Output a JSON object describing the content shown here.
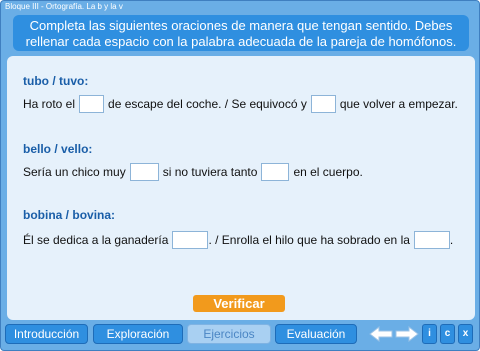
{
  "window": {
    "title": "Bloque III - Ortografía. La b y la v"
  },
  "instructions": "Completa las siguientes oraciones de manera que tengan sentido. Debes rellenar cada espacio con la palabra adecuada de la pareja de homófonos.",
  "exercises": [
    {
      "word1": "tubo",
      "slash": "/",
      "word2": "tuvo",
      "colon": ":",
      "parts": [
        "Ha roto el",
        "de escape del coche. / Se equivocó y",
        "que volver a empezar."
      ],
      "blanks": [
        "",
        ""
      ]
    },
    {
      "word1": "bello",
      "slash": "/",
      "word2": "vello",
      "colon": ":",
      "parts": [
        "Sería un chico muy",
        "si no tuviera tanto",
        "en el cuerpo."
      ],
      "blanks": [
        "",
        ""
      ]
    },
    {
      "word1": "bobina",
      "slash": "/",
      "word2": "bovina",
      "colon": ":",
      "parts": [
        "Él se dedica a la ganadería",
        ". / Enrolla el hilo que ha sobrado en la",
        "."
      ],
      "blanks": [
        "",
        ""
      ]
    }
  ],
  "verify_label": "Verificar",
  "nav": {
    "tabs": [
      "Introducción",
      "Exploración",
      "Ejercicios",
      "Evaluación"
    ],
    "active_tab": "Ejercicios",
    "prev_icon": "arrow-left-icon",
    "next_icon": "arrow-right-icon",
    "info_label": "i",
    "credits_label": "c",
    "close_label": "x"
  },
  "colors": {
    "frame": "#6aaee6",
    "accent": "#2f8fe0",
    "content_bg": "#e6f1fb",
    "pair_text": "#1a5ea8",
    "verify": "#f29a1c"
  }
}
